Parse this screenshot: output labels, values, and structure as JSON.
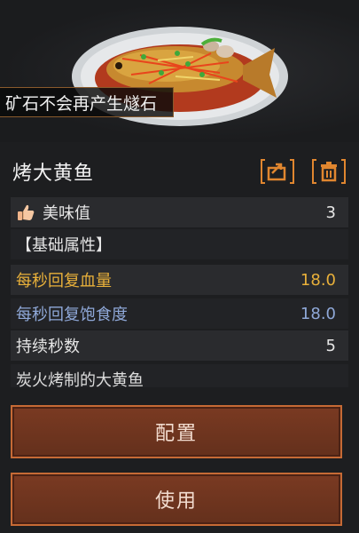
{
  "banner": {
    "text": "矿石不会再产生燧石"
  },
  "item": {
    "name": "烤大黄鱼"
  },
  "stats": {
    "tasty": {
      "label": "美味值",
      "value": "3"
    },
    "section_header": "【基础属性】",
    "hp_regen": {
      "label": "每秒回复血量",
      "value": "18.0"
    },
    "satiety_regen": {
      "label": "每秒回复饱食度",
      "value": "18.0"
    },
    "duration": {
      "label": "持续秒数",
      "value": "5"
    }
  },
  "description": "炭火烤制的大黄鱼",
  "buttons": {
    "configure": "配置",
    "use": "使用"
  },
  "colors": {
    "accent_orange": "#e0862f",
    "gold_text": "#e8b03a",
    "blue_text": "#8fa8d8",
    "button_bg": "#6e341f"
  },
  "icons": {
    "share": "share-icon",
    "delete": "trash-icon",
    "tasty": "thumbs-up-icon"
  }
}
